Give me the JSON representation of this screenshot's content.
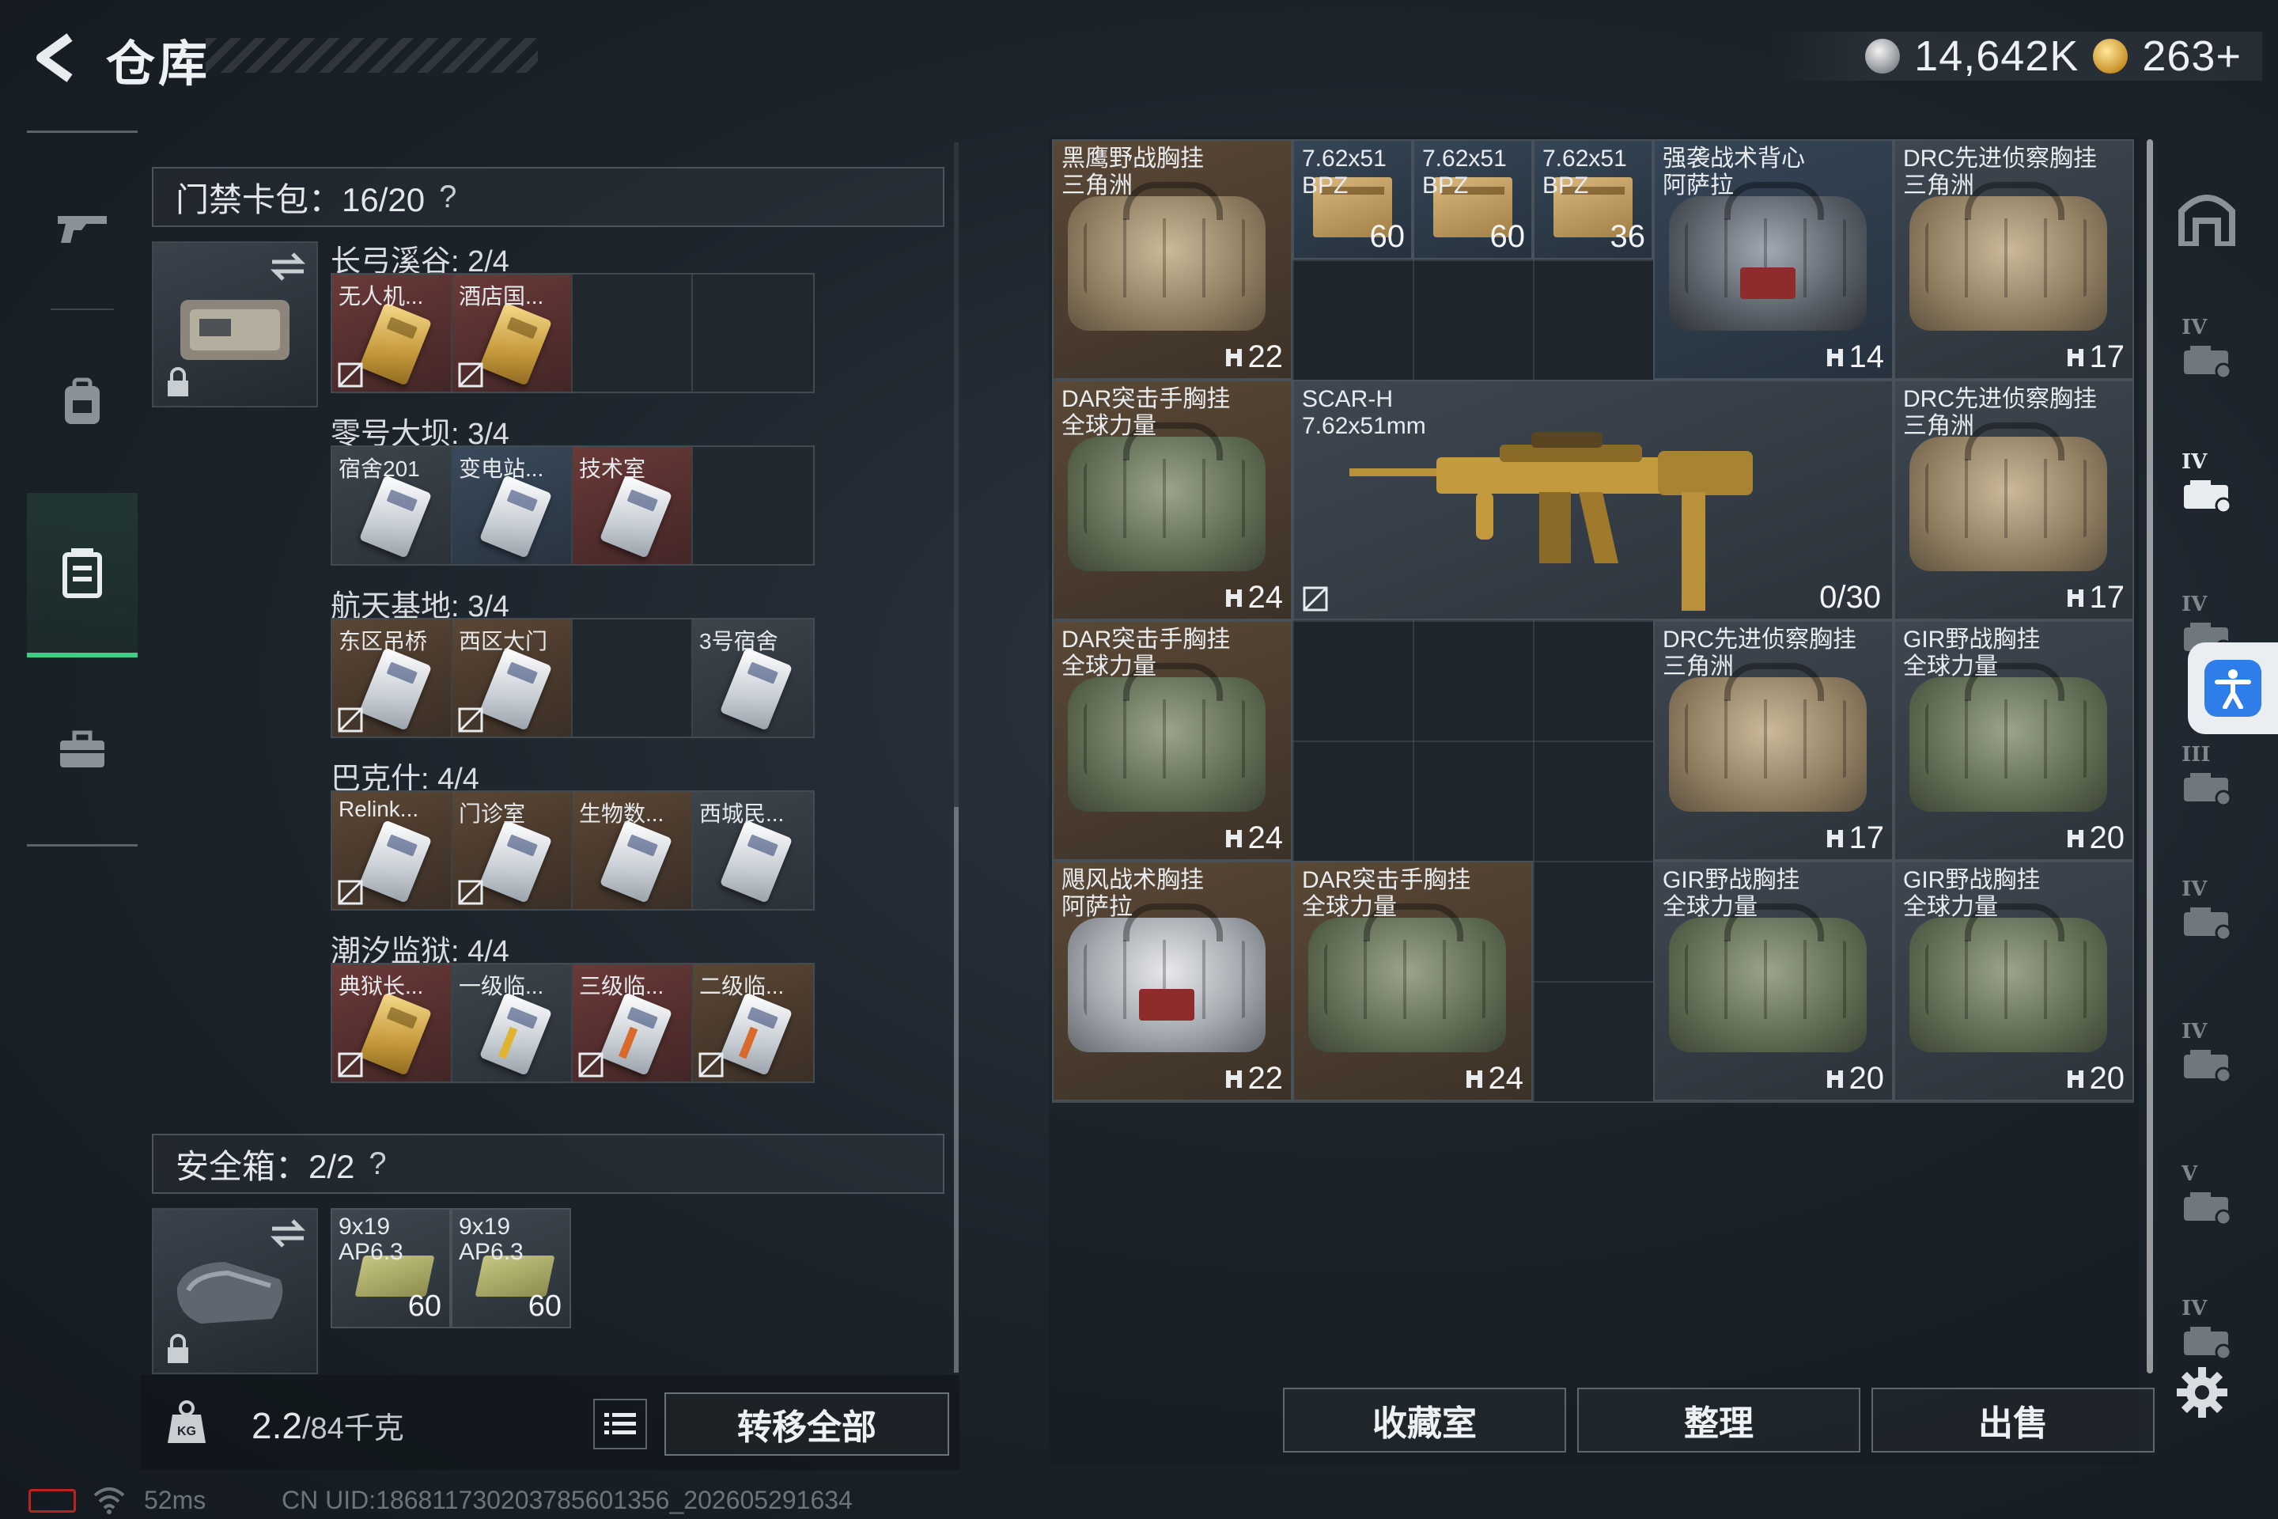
{
  "header": {
    "title": "仓库",
    "silver_value": "14,642K",
    "gold_value": "263+"
  },
  "left_rail": {
    "items": [
      "weapon-icon",
      "backpack-icon",
      "chest-rig-icon",
      "case-icon"
    ],
    "active_index": 2
  },
  "keycard": {
    "header_label": "门禁卡包：16/20",
    "help": "?",
    "groups": [
      {
        "label": "长弓溪谷: 2/4",
        "cards": [
          {
            "name": "无人机...",
            "color": "red",
            "art": "gold",
            "unbindable": true
          },
          {
            "name": "酒店国...",
            "color": "red",
            "art": "gold",
            "unbindable": true
          },
          {
            "name": "",
            "color": "empty"
          },
          {
            "name": "",
            "color": "empty"
          }
        ]
      },
      {
        "label": "零号大坝: 3/4",
        "cards": [
          {
            "name": "宿舍201",
            "color": "gray",
            "art": "white",
            "unbindable": false
          },
          {
            "name": "变电站...",
            "color": "blue",
            "art": "white",
            "unbindable": false
          },
          {
            "name": "技术室",
            "color": "red",
            "art": "white",
            "unbindable": false
          },
          {
            "name": "",
            "color": "empty"
          }
        ]
      },
      {
        "label": "航天基地: 3/4",
        "cards": [
          {
            "name": "东区吊桥",
            "color": "brown",
            "art": "white",
            "unbindable": true
          },
          {
            "name": "西区大门",
            "color": "brown",
            "art": "white",
            "unbindable": true
          },
          {
            "name": "",
            "color": "empty"
          },
          {
            "name": "3号宿舍",
            "color": "gray",
            "art": "white",
            "unbindable": false
          }
        ]
      },
      {
        "label": "巴克什: 4/4",
        "cards": [
          {
            "name": "Relink...",
            "color": "brown",
            "art": "white",
            "unbindable": true
          },
          {
            "name": "门诊室",
            "color": "brown",
            "art": "white",
            "unbindable": true
          },
          {
            "name": "生物数...",
            "color": "brown",
            "art": "white",
            "unbindable": false
          },
          {
            "name": "西城民...",
            "color": "gray",
            "art": "white",
            "unbindable": false
          }
        ]
      },
      {
        "label": "潮汐监狱: 4/4",
        "cards": [
          {
            "name": "典狱长...",
            "color": "red",
            "art": "gold",
            "unbindable": true
          },
          {
            "name": "一级临...",
            "color": "gray",
            "art": "yellow",
            "unbindable": false
          },
          {
            "name": "三级临...",
            "color": "red",
            "art": "red",
            "unbindable": true
          },
          {
            "name": "二级临...",
            "color": "brown",
            "art": "red",
            "unbindable": true
          }
        ]
      }
    ]
  },
  "safe_box": {
    "header_label": "安全箱：2/2",
    "help": "?",
    "items": [
      {
        "name": "9x19",
        "sub": "AP6.3",
        "count": "60"
      },
      {
        "name": "9x19",
        "sub": "AP6.3",
        "count": "60"
      }
    ]
  },
  "weight": {
    "value": "2.2",
    "max": "/84千克",
    "unit_badge": "KG"
  },
  "transfer_all_label": "转移全部",
  "grid_items": [
    {
      "id": "v1",
      "name": "黑鹰野战胸挂",
      "sub": "三角洲",
      "count": "22",
      "tone": "brown",
      "art": "sand"
    },
    {
      "id": "a1",
      "name": "7.62x51",
      "sub": "BPZ",
      "count": "60"
    },
    {
      "id": "a2",
      "name": "7.62x51",
      "sub": "BPZ",
      "count": "60"
    },
    {
      "id": "a3",
      "name": "7.62x51",
      "sub": "BPZ",
      "count": "36"
    },
    {
      "id": "v2",
      "name": "强袭战术背心",
      "sub": "阿萨拉",
      "count": "14",
      "tone": "blue",
      "art": "dark"
    },
    {
      "id": "v3",
      "name": "DRC先进侦察胸挂",
      "sub": "三角洲",
      "count": "17",
      "tone": "gray",
      "art": "sand"
    },
    {
      "id": "v4",
      "name": "DAR突击手胸挂",
      "sub": "全球力量",
      "count": "24",
      "tone": "brown",
      "art": "green"
    },
    {
      "id": "gun",
      "name": "SCAR-H",
      "sub": "7.62x51mm",
      "count": "0/30"
    },
    {
      "id": "v5",
      "name": "DRC先进侦察胸挂",
      "sub": "三角洲",
      "count": "17",
      "tone": "gray",
      "art": "sand"
    },
    {
      "id": "v6",
      "name": "DAR突击手胸挂",
      "sub": "全球力量",
      "count": "24",
      "tone": "brown",
      "art": "green"
    },
    {
      "id": "v7",
      "name": "DRC先进侦察胸挂",
      "sub": "三角洲",
      "count": "17",
      "tone": "gray",
      "art": "sand"
    },
    {
      "id": "v8",
      "name": "GIR野战胸挂",
      "sub": "全球力量",
      "count": "20",
      "tone": "gray",
      "art": "green"
    },
    {
      "id": "v9",
      "name": "飓风战术胸挂",
      "sub": "阿萨拉",
      "count": "22",
      "tone": "brown",
      "art": "snow"
    },
    {
      "id": "v10",
      "name": "DAR突击手胸挂",
      "sub": "全球力量",
      "count": "24",
      "tone": "brown",
      "art": "green"
    },
    {
      "id": "v11",
      "name": "GIR野战胸挂",
      "sub": "全球力量",
      "count": "20",
      "tone": "gray",
      "art": "green"
    },
    {
      "id": "v12",
      "name": "GIR野战胸挂",
      "sub": "全球力量",
      "count": "20",
      "tone": "gray",
      "art": "green"
    }
  ],
  "actions": {
    "collection": "收藏室",
    "sort": "整理",
    "sell": "出售"
  },
  "right_rail": {
    "tiers": [
      "IV",
      "IV",
      "IV",
      "III",
      "IV",
      "IV",
      "V",
      "IV"
    ]
  },
  "status": {
    "ping": "52ms",
    "uid": "CN UID:18681173020378560​1356_202605291634"
  },
  "colors": {
    "accent_green": "#3fce86",
    "accessibility_blue": "#2f7de8"
  }
}
